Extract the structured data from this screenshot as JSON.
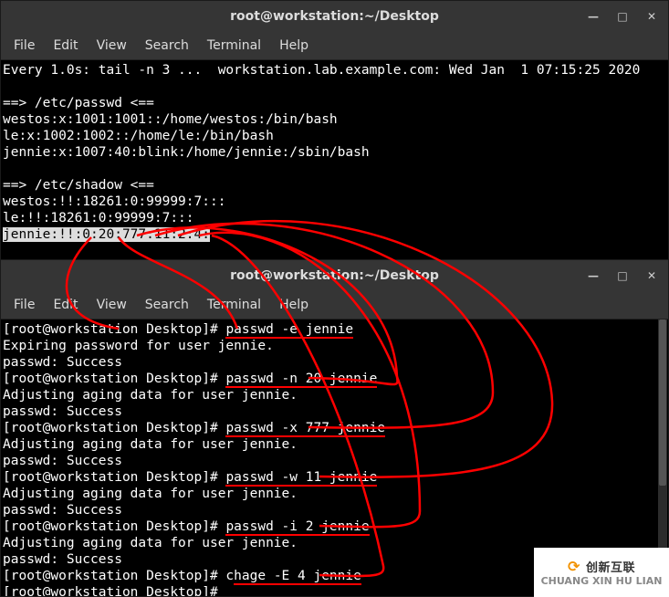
{
  "window1": {
    "title": "root@workstation:~/Desktop",
    "menu": [
      "File",
      "Edit",
      "View",
      "Search",
      "Terminal",
      "Help"
    ],
    "lines": [
      "Every 1.0s: tail -n 3 ...  workstation.lab.example.com: Wed Jan  1 07:15:25 2020",
      "",
      "==> /etc/passwd <==",
      "westos:x:1001:1001::/home/westos:/bin/bash",
      "le:x:1002:1002::/home/le:/bin/bash",
      "jennie:x:1007:40:blink:/home/jennie:/sbin/bash",
      "",
      "==> /etc/shadow <==",
      "westos:!!:18261:0:99999:7:::",
      "le:!!:18261:0:99999:7:::"
    ],
    "highlighted_line": "jennie:!!:0:20:777:11:2:4:"
  },
  "window2": {
    "title": "root@workstation:~/Desktop",
    "menu": [
      "File",
      "Edit",
      "View",
      "Search",
      "Terminal",
      "Help"
    ],
    "lines": [
      {
        "prompt": "[root@workstation Desktop]# ",
        "cmd": "passwd -e jennie",
        "ul": true
      },
      {
        "text": "Expiring password for user jennie."
      },
      {
        "text": "passwd: Success"
      },
      {
        "prompt": "[root@workstation Desktop]# ",
        "cmd": "passwd -n 20 jennie",
        "ul": true
      },
      {
        "text": "Adjusting aging data for user jennie."
      },
      {
        "text": "passwd: Success"
      },
      {
        "prompt": "[root@workstation Desktop]# ",
        "cmd": "passwd -x 777 jennie",
        "ul": true
      },
      {
        "text": "Adjusting aging data for user jennie."
      },
      {
        "text": "passwd: Success"
      },
      {
        "prompt": "[root@workstation Desktop]# ",
        "cmd": "passwd -w 11 jennie",
        "ul": true
      },
      {
        "text": "Adjusting aging data for user jennie."
      },
      {
        "text": "passwd: Success"
      },
      {
        "prompt": "[root@workstation Desktop]# ",
        "cmd": "passwd -i 2 jennie",
        "ul": true
      },
      {
        "text": "Adjusting aging data for user jennie."
      },
      {
        "text": "passwd: Success"
      },
      {
        "prompt": "[root@workstation Desktop]# ",
        "cmd": "chage -E 4 jennie",
        "ul": true,
        "prefix": "c",
        "cmdText": "hage -E 4 jennie"
      },
      {
        "prompt": "[root@workstation Desktop]# ",
        "cmd": ""
      }
    ]
  },
  "watermark": {
    "brand": "创新互联",
    "sub": "CHUANG XIN HU LIAN"
  },
  "controls": {
    "min": "—",
    "max": "□",
    "close": "✕"
  }
}
